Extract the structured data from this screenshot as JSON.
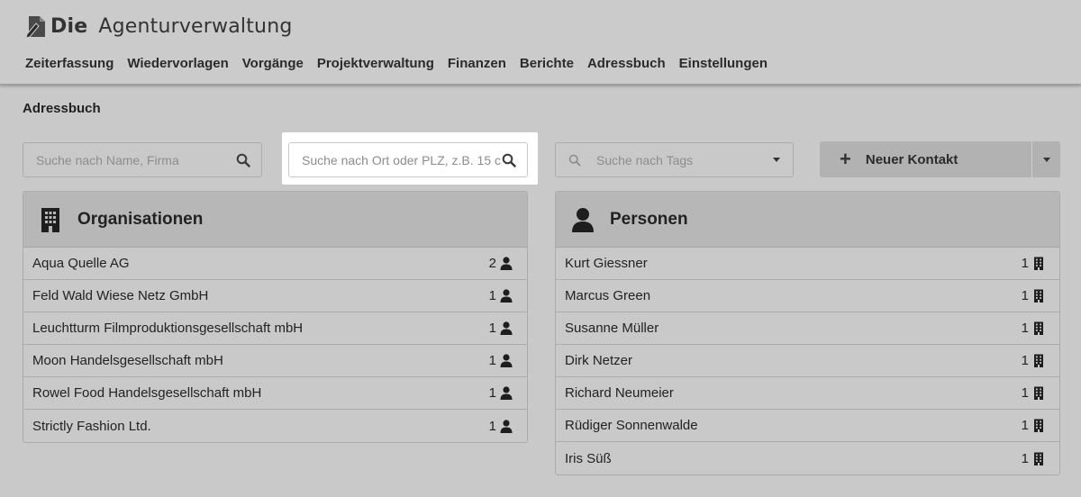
{
  "app": {
    "logo_die": "Die",
    "logo_rest": "Agenturverwaltung"
  },
  "nav": {
    "items": [
      "Zeiterfassung",
      "Wiedervorlagen",
      "Vorgänge",
      "Projektverwaltung",
      "Finanzen",
      "Berichte",
      "Adressbuch",
      "Einstellungen"
    ]
  },
  "page": {
    "title": "Adressbuch"
  },
  "search": {
    "name_placeholder": "Suche nach Name, Firma",
    "ort_placeholder": "Suche nach Ort oder PLZ, z.B. 15 c",
    "tags_placeholder": "Suche nach Tags"
  },
  "new_contact": {
    "label": "Neuer Kontakt"
  },
  "organisations": {
    "title": "Organisationen",
    "rows": [
      {
        "name": "Aqua Quelle AG",
        "count": "2"
      },
      {
        "name": "Feld Wald Wiese Netz GmbH",
        "count": "1"
      },
      {
        "name": "Leuchtturm Filmproduktionsgesellschaft mbH",
        "count": "1"
      },
      {
        "name": "Moon Handelsgesellschaft mbH",
        "count": "1"
      },
      {
        "name": "Rowel Food Handelsgesellschaft mbH",
        "count": "1"
      },
      {
        "name": "Strictly Fashion Ltd.",
        "count": "1"
      }
    ]
  },
  "persons": {
    "title": "Personen",
    "rows": [
      {
        "name": "Kurt Giessner",
        "count": "1"
      },
      {
        "name": "Marcus Green",
        "count": "1"
      },
      {
        "name": "Susanne Müller",
        "count": "1"
      },
      {
        "name": "Dirk Netzer",
        "count": "1"
      },
      {
        "name": "Richard Neumeier",
        "count": "1"
      },
      {
        "name": "Rüdiger Sonnenwalde",
        "count": "1"
      },
      {
        "name": "Iris Süß",
        "count": "1"
      }
    ]
  },
  "colors": {
    "background": "#c9c9c9",
    "panel_header": "#b7b7b7",
    "button": "#b2b2b2",
    "highlight": "#ffffff"
  },
  "icons": {
    "logo": "pen-document-icon",
    "search": "search-icon",
    "plus": "plus-icon",
    "org": "building-icon",
    "person": "person-icon"
  }
}
